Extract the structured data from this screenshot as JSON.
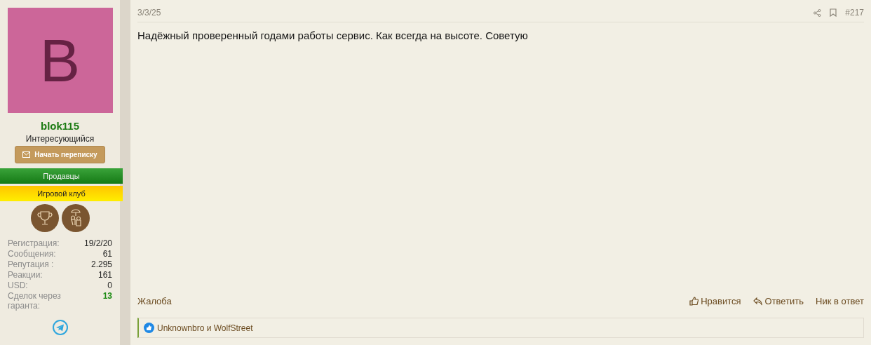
{
  "user": {
    "avatar_letter": "B",
    "name": "blok115",
    "title": "Интересующийся",
    "message_button": "Начать переписку",
    "banners": [
      {
        "label": "Продавцы",
        "kind": "green"
      },
      {
        "label": "Игровой клуб",
        "kind": "yellow"
      }
    ],
    "stats": [
      {
        "label": "Регистрация:",
        "value": "19/2/20",
        "highlight": false
      },
      {
        "label": "Сообщения:",
        "value": "61",
        "highlight": false
      },
      {
        "label": "Репутация :",
        "value": "2.295",
        "highlight": false
      },
      {
        "label": "Реакции:",
        "value": "161",
        "highlight": false
      },
      {
        "label": "USD:",
        "value": "0",
        "highlight": false
      },
      {
        "label": "Сделок через гаранта:",
        "value": "13",
        "highlight": true
      }
    ]
  },
  "post": {
    "date": "3/3/25",
    "number": "#217",
    "text": "Надёжный проверенный годами работы сервис. Как всегда на высоте. Советую",
    "report": "Жалоба",
    "actions": [
      {
        "label": "Нравится",
        "kind": "like"
      },
      {
        "label": "Ответить",
        "kind": "reply"
      },
      {
        "label": "Ник в ответ",
        "kind": "plain"
      }
    ],
    "reactions": "Unknownbro и WolfStreet"
  }
}
